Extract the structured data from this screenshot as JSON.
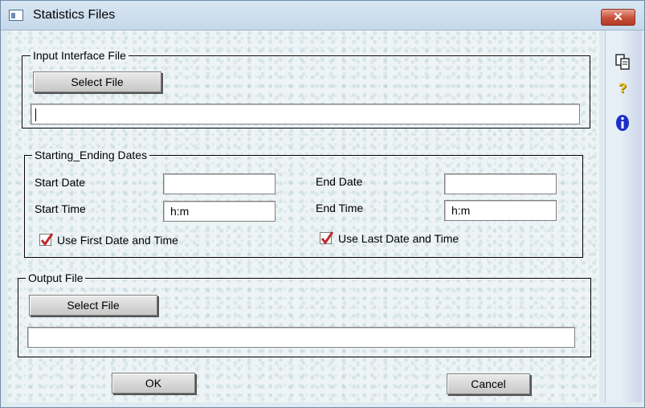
{
  "window": {
    "title": "Statistics Files",
    "close_label": "✕"
  },
  "input_group": {
    "legend": "Input Interface File",
    "select_label": "Select File",
    "path_value": ""
  },
  "dates_group": {
    "legend": "Starting_Ending Dates",
    "start_date_label": "Start Date",
    "start_date_value": "",
    "start_time_label": "Start Time",
    "start_time_value": "h:m",
    "end_date_label": "End Date",
    "end_date_value": "",
    "end_time_label": "End Time",
    "end_time_value": "h:m",
    "use_first_label": "Use First Date and Time",
    "use_first_checked": true,
    "use_last_label": "Use Last Date and Time",
    "use_last_checked": true
  },
  "output_group": {
    "legend": "Output File",
    "select_label": "Select File",
    "path_value": ""
  },
  "footer": {
    "ok_label": "OK",
    "cancel_label": "Cancel"
  },
  "side_icons": [
    "copy-icon",
    "help-icon",
    "info-icon"
  ],
  "colors": {
    "check_mark": "#c0272d",
    "info": "#1b2fc8",
    "help": "#e8c000",
    "close": "#c7503a"
  }
}
